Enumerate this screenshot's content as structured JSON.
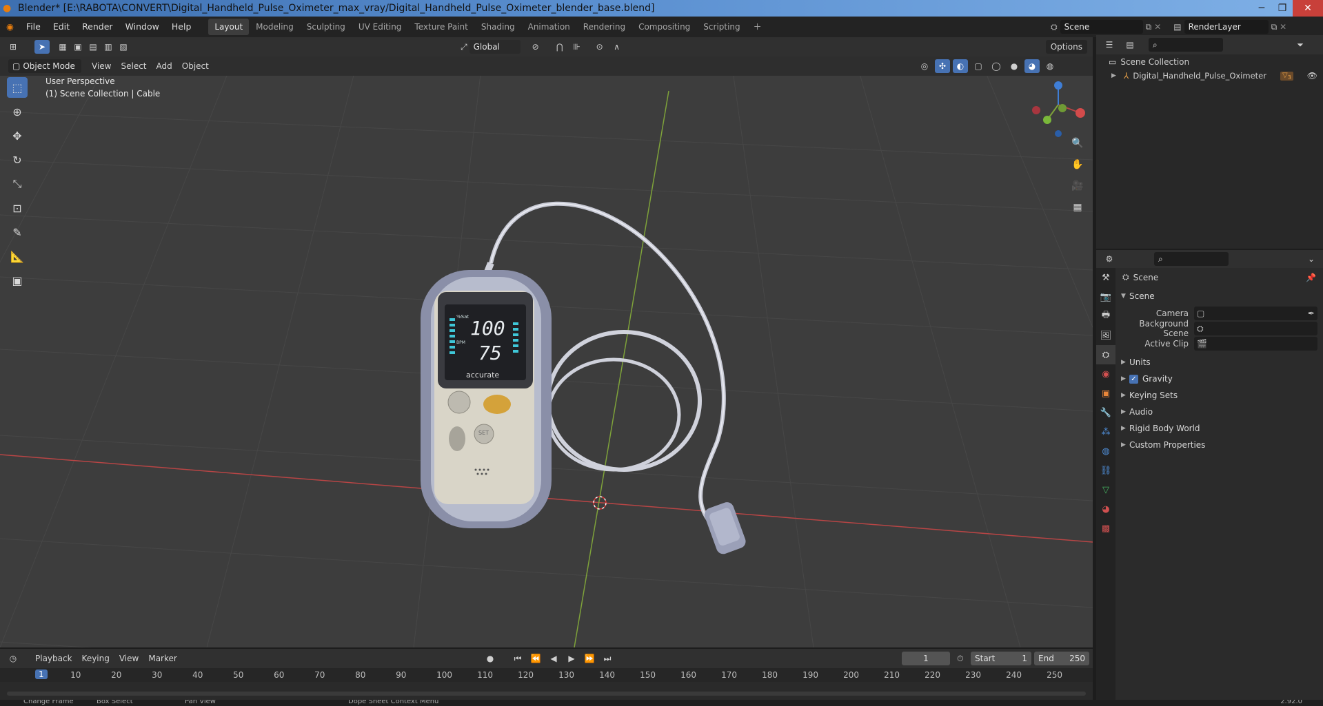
{
  "window": {
    "title": "Blender* [E:\\RABOTA\\CONVERT\\Digital_Handheld_Pulse_Oximeter_max_vray/Digital_Handheld_Pulse_Oximeter_blender_base.blend]"
  },
  "menu": [
    "File",
    "Edit",
    "Render",
    "Window",
    "Help"
  ],
  "workspaces": [
    "Layout",
    "Modeling",
    "Sculpting",
    "UV Editing",
    "Texture Paint",
    "Shading",
    "Animation",
    "Rendering",
    "Compositing",
    "Scripting"
  ],
  "active_workspace": "Layout",
  "scene_field": "Scene",
  "render_layer_field": "RenderLayer",
  "viewport_header": {
    "mode": "Object Mode",
    "menus": [
      "View",
      "Select",
      "Add",
      "Object"
    ],
    "transform_orientation": "Global",
    "options": "Options"
  },
  "viewport": {
    "perspective": "User Perspective",
    "collection": "(1) Scene Collection | Cable"
  },
  "device_screen": {
    "spo2": "100",
    "bpm": "75",
    "spo2_label": "%Sat",
    "bpm_label": "BPM",
    "brand": "accurate",
    "set_label": "SET"
  },
  "outliner": {
    "root": "Scene Collection",
    "items": [
      {
        "name": "Digital_Handheld_Pulse_Oximeter",
        "badge": "3"
      }
    ]
  },
  "properties": {
    "context": "Scene",
    "section": "Scene",
    "rows": [
      {
        "label": "Camera"
      },
      {
        "label": "Background Scene"
      },
      {
        "label": "Active Clip"
      }
    ],
    "subsections": [
      "Units",
      "Gravity",
      "Keying Sets",
      "Audio",
      "Rigid Body World",
      "Custom Properties"
    ],
    "gravity_checked": true
  },
  "timeline": {
    "menus": [
      "Playback",
      "Keying",
      "View",
      "Marker"
    ],
    "current_frame": "1",
    "start_label": "Start",
    "start": "1",
    "end_label": "End",
    "end": "250",
    "ticks": [
      "1",
      "10",
      "20",
      "30",
      "40",
      "50",
      "60",
      "70",
      "80",
      "90",
      "100",
      "110",
      "120",
      "130",
      "140",
      "150",
      "160",
      "170",
      "180",
      "190",
      "200",
      "210",
      "220",
      "230",
      "240",
      "250"
    ]
  },
  "statusbar": {
    "items": [
      "Change Frame",
      "Box Select",
      "Pan View",
      "Dope Sheet Context Menu"
    ],
    "version": "2.92.0"
  },
  "colors": {
    "accent": "#4772b3",
    "viewport_bg": "#3d3d3d",
    "x_axis": "#b84545",
    "y_axis": "#7ea23a",
    "z_axis": "#3f7ed6",
    "screen_digits": "#e8ecef",
    "screen_bars": "#3fc7d8"
  }
}
